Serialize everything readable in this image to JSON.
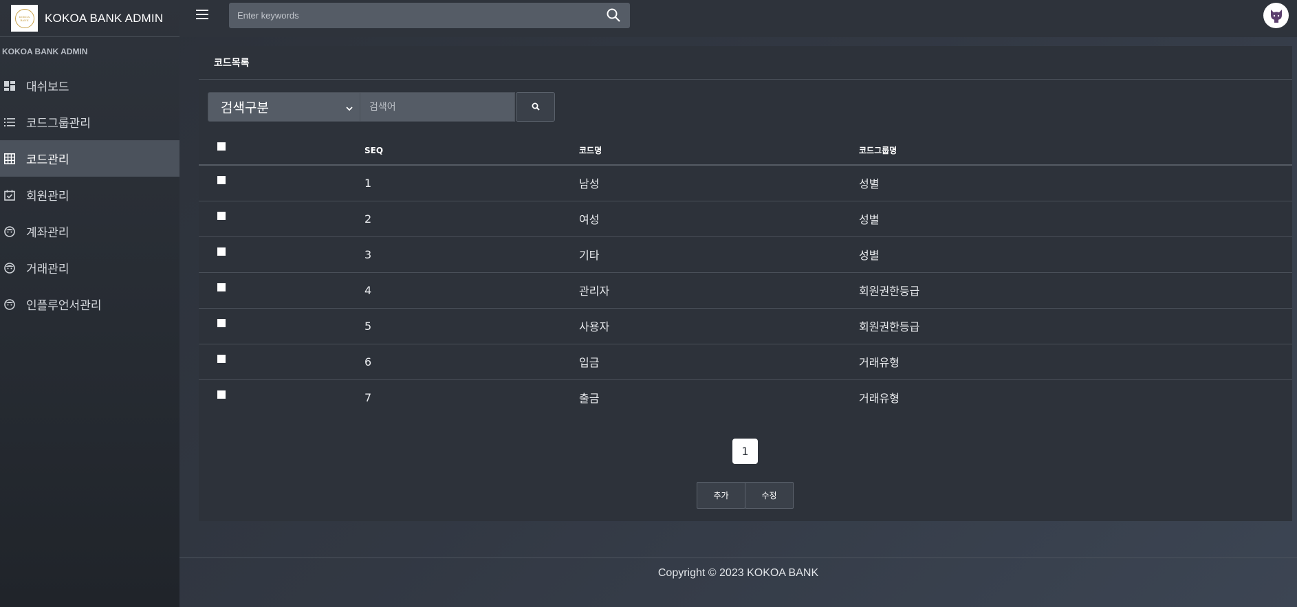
{
  "brand": {
    "name": "KOKOA BANK ADMIN",
    "logo_text": "KOKOA BANK"
  },
  "sidebar": {
    "heading": "KOKOA BANK ADMIN",
    "items": [
      {
        "label": "대쉬보드",
        "icon": "dashboard-icon"
      },
      {
        "label": "코드그룹관리",
        "icon": "list-icon"
      },
      {
        "label": "코드관리",
        "icon": "grid-icon",
        "active": true
      },
      {
        "label": "회원관리",
        "icon": "calendar-check-icon"
      },
      {
        "label": "계좌관리",
        "icon": "face-icon"
      },
      {
        "label": "거래관리",
        "icon": "face-icon"
      },
      {
        "label": "인플루언서관리",
        "icon": "face-icon"
      }
    ]
  },
  "topbar": {
    "search_placeholder": "Enter keywords"
  },
  "card": {
    "title": "코드목록",
    "filter": {
      "select_value": "검색구분",
      "input_placeholder": "검색어"
    },
    "table": {
      "headers": [
        "SEQ",
        "코드명",
        "코드그룹명"
      ],
      "rows": [
        {
          "seq": "1",
          "name": "남성",
          "group": "성별"
        },
        {
          "seq": "2",
          "name": "여성",
          "group": "성별"
        },
        {
          "seq": "3",
          "name": "기타",
          "group": "성별"
        },
        {
          "seq": "4",
          "name": "관리자",
          "group": "회원권한등급"
        },
        {
          "seq": "5",
          "name": "사용자",
          "group": "회원권한등급"
        },
        {
          "seq": "6",
          "name": "입금",
          "group": "거래유형"
        },
        {
          "seq": "7",
          "name": "출금",
          "group": "거래유형"
        }
      ]
    },
    "pagination": {
      "current": "1"
    },
    "buttons": {
      "add": "추가",
      "edit": "수정"
    }
  },
  "footer": {
    "text": "Copyright © 2023 KOKOA BANK"
  },
  "colors": {
    "active_menu": "#4b525c",
    "card_bg": "#2d323a",
    "input_bg": "#555c66"
  }
}
